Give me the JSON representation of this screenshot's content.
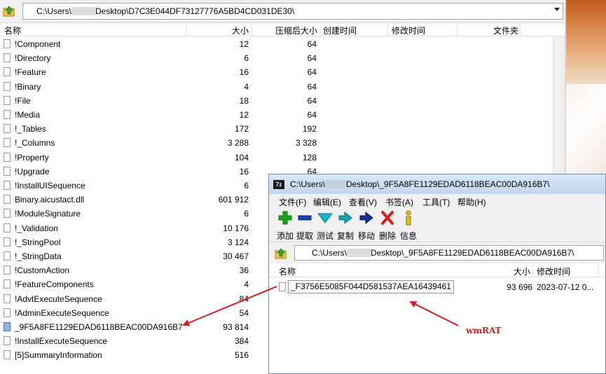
{
  "main_window": {
    "path_prefix": "C:\\Users\\",
    "path_suffix": "Desktop\\D7C3E044DF73127776A5BD4CD031DE30\\",
    "columns": [
      "名称",
      "大小",
      "压缩后大小",
      "创建时间",
      "修改时间",
      "文件夹"
    ],
    "rows": [
      {
        "name": "!Component",
        "size": "12",
        "packed": "64"
      },
      {
        "name": "!Directory",
        "size": "6",
        "packed": "64"
      },
      {
        "name": "!Feature",
        "size": "16",
        "packed": "64"
      },
      {
        "name": "!Binary",
        "size": "4",
        "packed": "64"
      },
      {
        "name": "!File",
        "size": "18",
        "packed": "64"
      },
      {
        "name": "!Media",
        "size": "12",
        "packed": "64"
      },
      {
        "name": "!_Tables",
        "size": "172",
        "packed": "192"
      },
      {
        "name": "!_Columns",
        "size": "3 288",
        "packed": "3 328"
      },
      {
        "name": "!Property",
        "size": "104",
        "packed": "128"
      },
      {
        "name": "!Upgrade",
        "size": "16",
        "packed": "64"
      },
      {
        "name": "!InstallUISequence",
        "size": "6",
        "packed": ""
      },
      {
        "name": "Binary.aicustact.dll",
        "size": "601 912",
        "packed": ""
      },
      {
        "name": "!ModuleSignature",
        "size": "6",
        "packed": ""
      },
      {
        "name": "!_Validation",
        "size": "10 176",
        "packed": ""
      },
      {
        "name": "!_StringPool",
        "size": "3 124",
        "packed": ""
      },
      {
        "name": "!_StringData",
        "size": "30 467",
        "packed": ""
      },
      {
        "name": "!CustomAction",
        "size": "36",
        "packed": ""
      },
      {
        "name": "!FeatureComponents",
        "size": "4",
        "packed": ""
      },
      {
        "name": "!AdvtExecuteSequence",
        "size": "84",
        "packed": ""
      },
      {
        "name": "!AdminExecuteSequence",
        "size": "54",
        "packed": ""
      },
      {
        "name": "_9F5A8FE1129EDAD6118BEAC00DA916B7",
        "size": "93 814",
        "packed": ""
      },
      {
        "name": "!InstallExecuteSequence",
        "size": "384",
        "packed": ""
      },
      {
        "name": "[5]SummaryInformation",
        "size": "516",
        "packed": ""
      }
    ]
  },
  "archive_window": {
    "app_icon": "7z",
    "title_prefix": "C:\\Users\\",
    "title_suffix": "Desktop\\_9F5A8FE1129EDAD6118BEAC00DA916B7\\",
    "menu": [
      "文件(F)",
      "编辑(E)",
      "查看(V)",
      "书签(A)",
      "工具(T)",
      "帮助(H)"
    ],
    "toolbar": [
      {
        "label": "添加",
        "icon": "plus-icon",
        "color": "#1aa31a"
      },
      {
        "label": "提取",
        "icon": "minus-icon",
        "color": "#1a3fb0"
      },
      {
        "label": "测试",
        "icon": "check-icon",
        "color": "#19b5c8"
      },
      {
        "label": "复制",
        "icon": "copy-arrow-icon",
        "color": "#19a2b0"
      },
      {
        "label": "移动",
        "icon": "move-arrow-icon",
        "color": "#1a2f90"
      },
      {
        "label": "删除",
        "icon": "delete-x-icon",
        "color": "#d41f1f"
      },
      {
        "label": "信息",
        "icon": "info-icon",
        "color": "#e0c020"
      }
    ],
    "path_prefix": "C:\\Users\\",
    "path_suffix": "Desktop\\_9F5A8FE1129EDAD6118BEAC00DA916B7\\",
    "columns": [
      "名称",
      "大小",
      "修改时间"
    ],
    "row": {
      "name": "_F3756E5085F044D581537AEA16439461",
      "size": "93 696",
      "modified": "2023-07-12 0..."
    }
  },
  "annotation": {
    "label": "wmRAT",
    "color": "#d91c1c"
  }
}
